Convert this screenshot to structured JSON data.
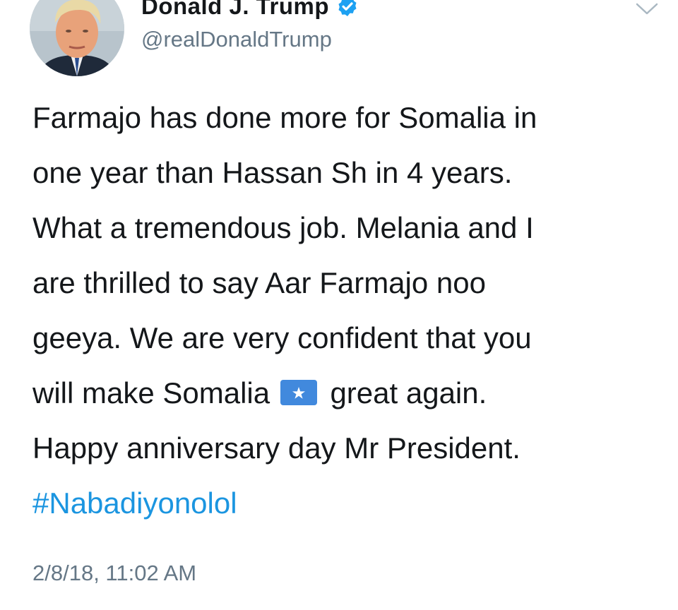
{
  "tweet": {
    "author": {
      "display_name": "Donald J. Trump",
      "handle": "@realDonaldTrump",
      "verified": true,
      "avatar_icon": "profile-photo"
    },
    "menu_icon": "chevron-down-icon",
    "text_lines": [
      "Farmajo has done more for Somalia in",
      "one year than Hassan Sh in 4 years.",
      "What a tremendous job. Melania and I",
      "are thrilled to say Aar Farmajo noo",
      "geeya. We are very confident that you"
    ],
    "line6_before_flag": "will make Somalia",
    "line6_after_flag": "great again.",
    "flag_icon": "somalia-flag-emoji",
    "line7": "Happy anniversary day Mr President.",
    "hashtag": "#Nabadiyonolol",
    "timestamp": "2/8/18, 11:02 AM"
  },
  "colors": {
    "text": "#14171a",
    "secondary_text": "#657786",
    "link": "#1b95e0",
    "verified_badge": "#1da1f2",
    "somalia_flag_blue": "#4189dd"
  }
}
